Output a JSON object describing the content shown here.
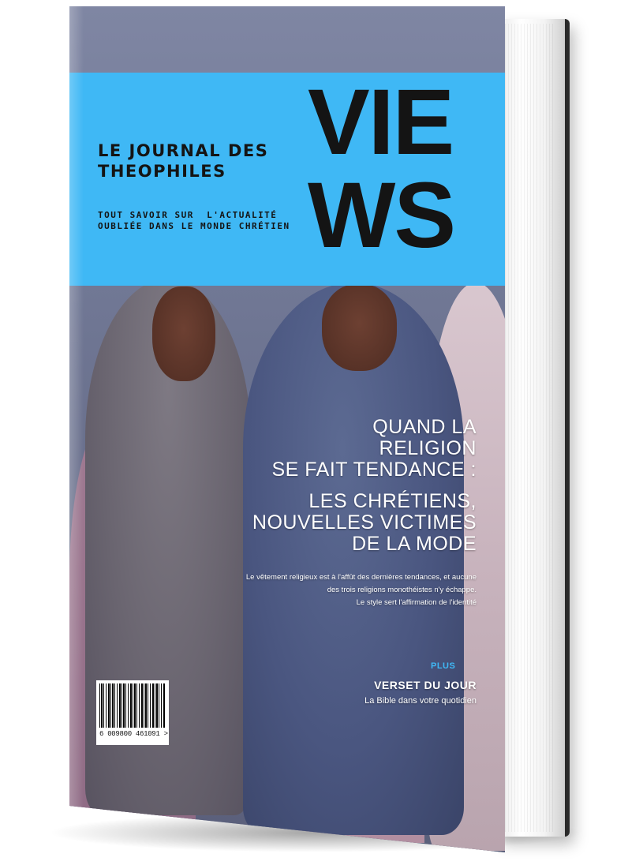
{
  "cover": {
    "masthead": [
      "VIE",
      "WS"
    ],
    "journal_title": [
      "LE JOURNAL DES",
      "THEOPHILES"
    ],
    "tagline": [
      "TOUT SAVOIR SUR  L'ACTUALITÉ",
      "OUBLIÉE DANS LE MONDE CHRÉTIEN"
    ],
    "headline_1": [
      "QUAND LA RELIGION",
      "SE FAIT TENDANCE :"
    ],
    "headline_2": [
      "LES CHRÉTIENS,",
      "NOUVELLES VICTIMES",
      "DE LA MODE"
    ],
    "summary": [
      "Le vêtement religieux est à l'affût des dernières tendances, et aucune",
      "des trois religions monothéistes n'y échappe.",
      "Le style sert l'affirmation de l'identité"
    ],
    "plus_label": "PLUS",
    "verse_title": "VERSET DU JOUR",
    "verse_subtitle": "La Bible dans votre quotidien",
    "barcode_number": "6 009800 461091 >"
  },
  "colors": {
    "band": "#3fb8f5",
    "masthead_text": "#141414",
    "headline_text": "#ffffff",
    "plus_accent": "#3fb8f5"
  }
}
